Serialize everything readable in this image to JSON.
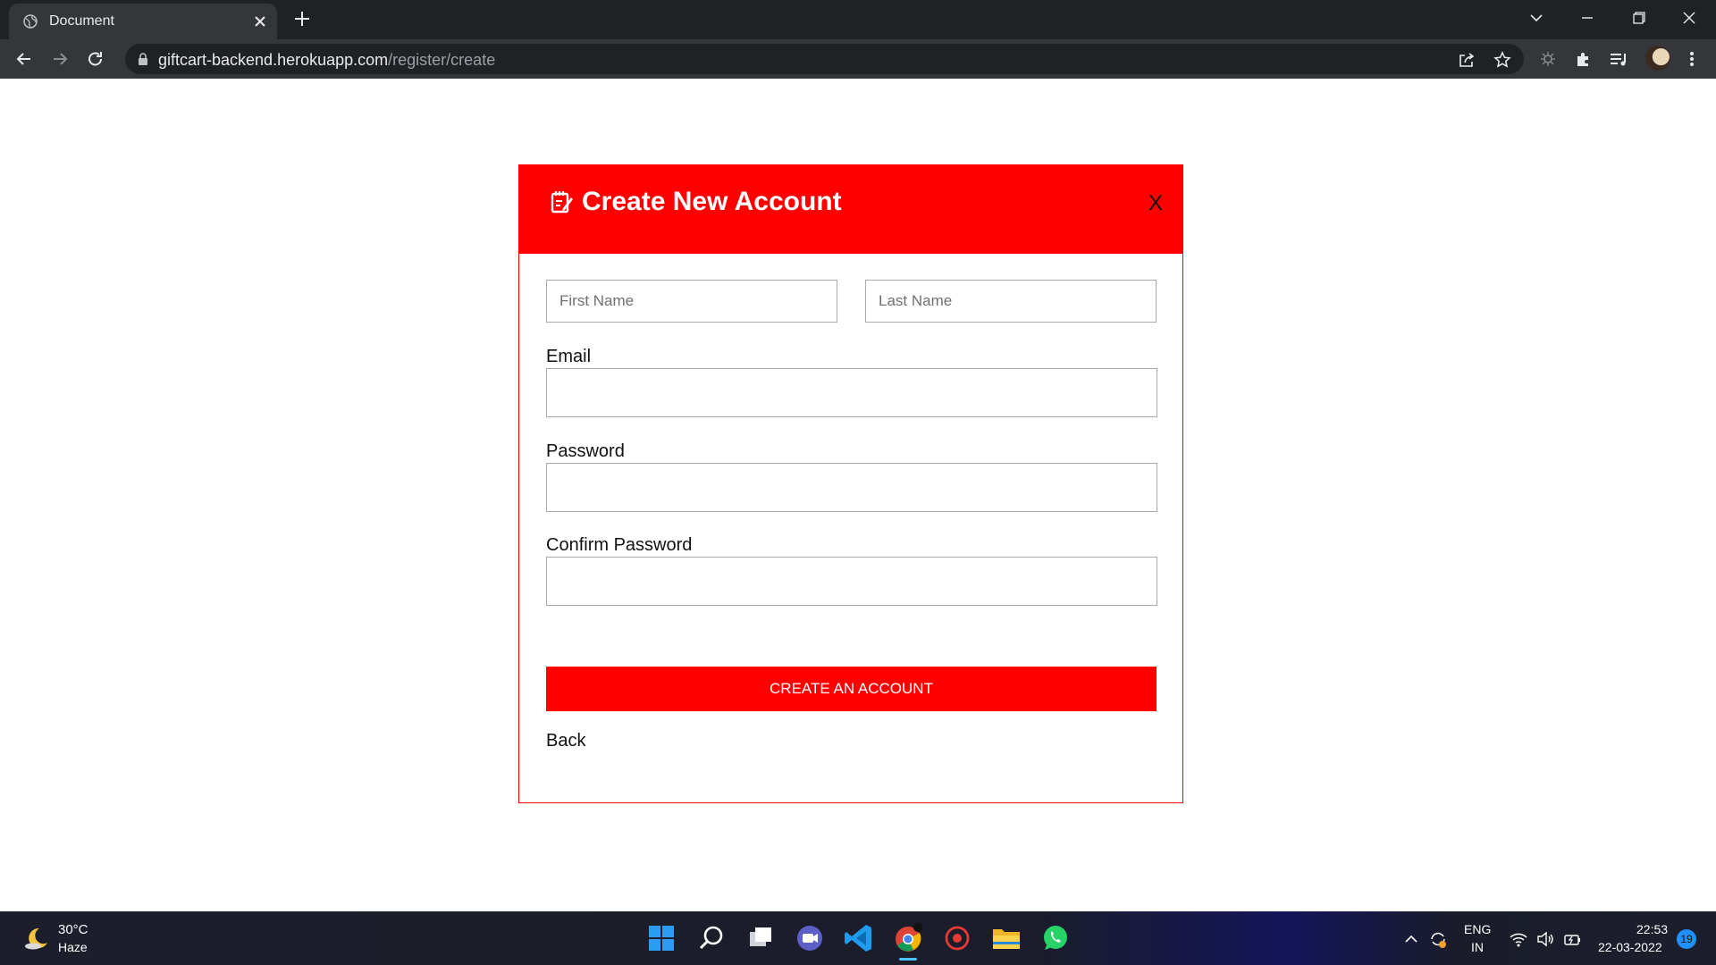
{
  "browser": {
    "tab": {
      "title": "Document",
      "favicon": "globe-icon"
    },
    "address": {
      "domain": "giftcart-backend.herokuapp.com",
      "path": "/register/create"
    }
  },
  "modal": {
    "title": "Create New Account",
    "title_icon": "memo-icon",
    "close_label": "X",
    "first_name": {
      "placeholder": "First Name",
      "value": ""
    },
    "last_name": {
      "placeholder": "Last Name",
      "value": ""
    },
    "email": {
      "label": "Email",
      "value": ""
    },
    "password": {
      "label": "Password",
      "value": ""
    },
    "confirm_password": {
      "label": "Confirm Password",
      "value": ""
    },
    "submit_label": "CREATE AN ACCOUNT",
    "back_label": "Back"
  },
  "taskbar": {
    "weather": {
      "temp": "30°C",
      "desc": "Haze"
    },
    "language": {
      "lang": "ENG",
      "region": "IN"
    },
    "clock": {
      "time": "22:53",
      "date": "22-03-2022"
    },
    "notifications": "19"
  },
  "colors": {
    "accent": "#ff0000",
    "chrome_dark": "#202124",
    "chrome_toolbar": "#35363a"
  }
}
